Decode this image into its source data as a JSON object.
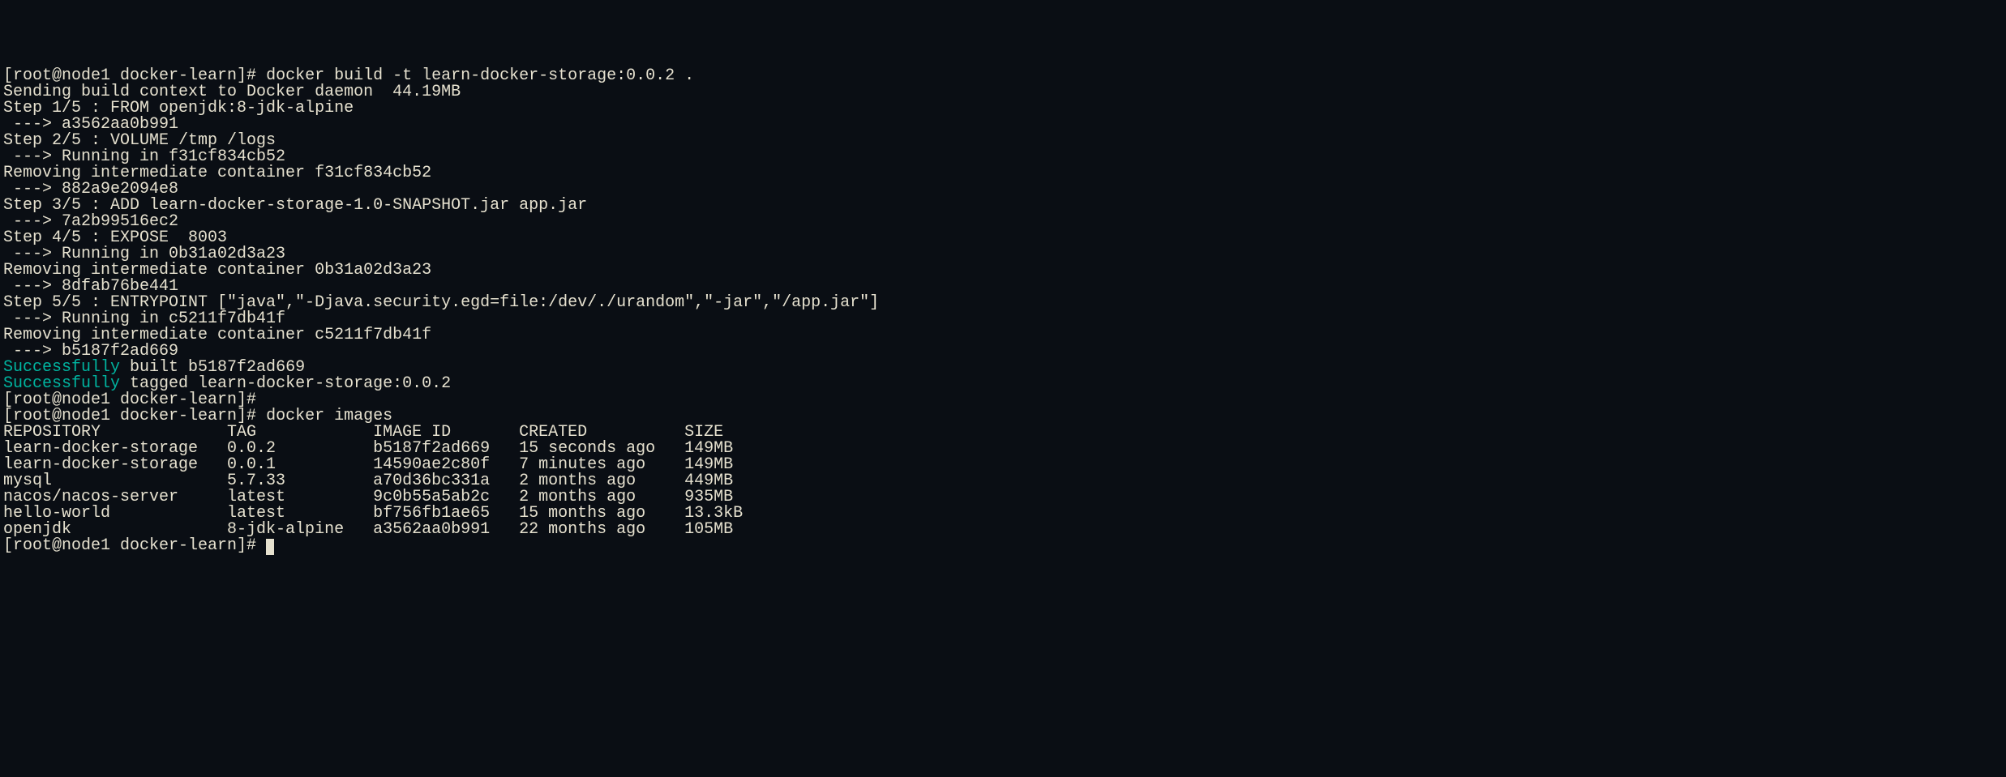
{
  "prompt1": "[root@node1 docker-learn]# ",
  "command1": "docker build -t learn-docker-storage:0.0.2 .",
  "build_output": [
    "Sending build context to Docker daemon  44.19MB",
    "Step 1/5 : FROM openjdk:8-jdk-alpine",
    " ---> a3562aa0b991",
    "Step 2/5 : VOLUME /tmp /logs",
    " ---> Running in f31cf834cb52",
    "Removing intermediate container f31cf834cb52",
    " ---> 882a9e2094e8",
    "Step 3/5 : ADD learn-docker-storage-1.0-SNAPSHOT.jar app.jar",
    " ---> 7a2b99516ec2",
    "Step 4/5 : EXPOSE  8003",
    " ---> Running in 0b31a02d3a23",
    "Removing intermediate container 0b31a02d3a23",
    " ---> 8dfab76be441",
    "Step 5/5 : ENTRYPOINT [\"java\",\"-Djava.security.egd=file:/dev/./urandom\",\"-jar\",\"/app.jar\"]",
    " ---> Running in c5211f7db41f",
    "Removing intermediate container c5211f7db41f",
    " ---> b5187f2ad669"
  ],
  "success1_prefix": "Successfully",
  "success1_rest": " built b5187f2ad669",
  "success2_prefix": "Successfully",
  "success2_rest": " tagged learn-docker-storage:0.0.2",
  "prompt2": "[root@node1 docker-learn]# ",
  "prompt3": "[root@node1 docker-learn]# ",
  "command2": "docker images",
  "images_header": {
    "repository": "REPOSITORY",
    "tag": "TAG",
    "image_id": "IMAGE ID",
    "created": "CREATED",
    "size": "SIZE"
  },
  "images": [
    {
      "repository": "learn-docker-storage",
      "tag": "0.0.2",
      "image_id": "b5187f2ad669",
      "created": "15 seconds ago",
      "size": "149MB"
    },
    {
      "repository": "learn-docker-storage",
      "tag": "0.0.1",
      "image_id": "14590ae2c80f",
      "created": "7 minutes ago",
      "size": "149MB"
    },
    {
      "repository": "mysql",
      "tag": "5.7.33",
      "image_id": "a70d36bc331a",
      "created": "2 months ago",
      "size": "449MB"
    },
    {
      "repository": "nacos/nacos-server",
      "tag": "latest",
      "image_id": "9c0b55a5ab2c",
      "created": "2 months ago",
      "size": "935MB"
    },
    {
      "repository": "hello-world",
      "tag": "latest",
      "image_id": "bf756fb1ae65",
      "created": "15 months ago",
      "size": "13.3kB"
    },
    {
      "repository": "openjdk",
      "tag": "8-jdk-alpine",
      "image_id": "a3562aa0b991",
      "created": "22 months ago",
      "size": "105MB"
    }
  ],
  "prompt4": "[root@node1 docker-learn]# "
}
